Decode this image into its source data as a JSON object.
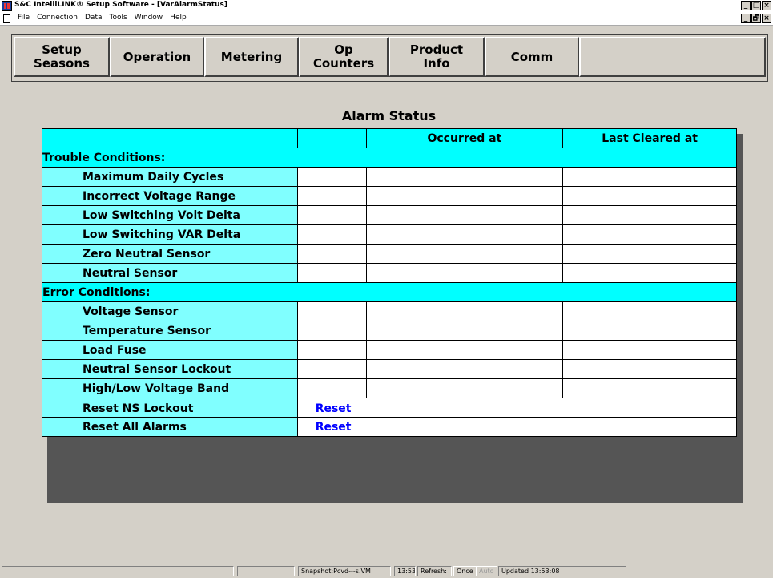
{
  "window": {
    "title": "S&C IntelliLINK® Setup Software - [VarAlarmStatus]",
    "title_buttons": [
      "_",
      "□",
      "×"
    ],
    "mdi_buttons": [
      "_",
      "🗗",
      "×"
    ]
  },
  "menu": [
    "File",
    "Connection",
    "Data",
    "Tools",
    "Window",
    "Help"
  ],
  "nav": {
    "setup_seasons": "Setup\nSeasons",
    "operation": "Operation",
    "metering": "Metering",
    "op_counters": "Op\nCounters",
    "product_info": "Product\nInfo",
    "comm": "Comm"
  },
  "alarm": {
    "title": "Alarm Status",
    "col_occurred": "Occurred at",
    "col_cleared": "Last Cleared at",
    "trouble_header": "Trouble Conditions:",
    "trouble_rows": [
      "Maximum Daily Cycles",
      "Incorrect Voltage Range",
      "Low Switching Volt Delta",
      "Low Switching VAR Delta",
      "Zero Neutral Sensor",
      "Neutral Sensor"
    ],
    "error_header": "Error Conditions:",
    "error_rows": [
      "Voltage Sensor",
      "Temperature Sensor",
      "Load Fuse",
      "Neutral Sensor Lockout",
      "High/Low Voltage Band"
    ],
    "reset_ns_label": "Reset NS Lockout",
    "reset_ns_link": "Reset",
    "reset_all_label": "Reset All Alarms",
    "reset_all_link": "Reset"
  },
  "status": {
    "snapshot": "Snapshot:Pcvd---s.VM",
    "time": "13:53",
    "refresh_label": "Refresh:",
    "once": "Once",
    "auto": "Auto",
    "updated": "Updated 13:53:08"
  }
}
